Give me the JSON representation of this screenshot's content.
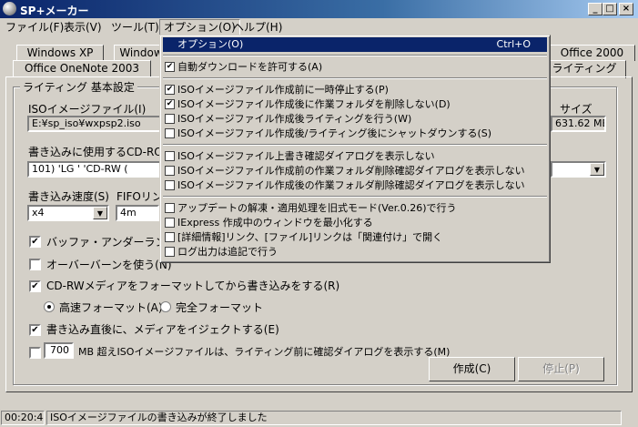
{
  "window": {
    "title": "SP+メーカー"
  },
  "titlebar_buttons": {
    "minimize": "_",
    "maximize": "□",
    "close": "×"
  },
  "menubar": [
    {
      "label": "ファイル(F)"
    },
    {
      "label": "表示(V)"
    },
    {
      "label": "ツール(T)"
    },
    {
      "label": "オプション(O)"
    },
    {
      "label": "ヘルプ(H)"
    }
  ],
  "tabs_back": [
    "Windows XP",
    "Window",
    "Office 2000"
  ],
  "tabs_front": [
    "Office OneNote 2003",
    "ライティング"
  ],
  "group": {
    "title": "ライティング 基本設定"
  },
  "iso": {
    "label": "ISOイメージファイル(I)",
    "value": "E:¥sp_iso¥wxpsp2.iso",
    "size_label": "サイズ",
    "size_value": "631.62 MB"
  },
  "drive": {
    "label": "書き込みに使用するCD-ROM",
    "value": "101) 'LG      ' 'CD-RW ("
  },
  "speed": {
    "label": "書き込み速度(S)",
    "value": "x4"
  },
  "fifo": {
    "label": "FIFOリン",
    "value": "4m"
  },
  "options": {
    "buffer_underrun": "バッファ・アンダーラン防止",
    "overburn": "オーバーバーンを使う(N)",
    "format_cdrw": "CD-RWメディアをフォーマットしてから書き込みをする(R)",
    "quick_format": "高速フォーマット(A)",
    "full_format": "完全フォーマット",
    "eject": "書き込み直後に、メディアをイジェクトする(E)",
    "mb_value": "700",
    "mb_label": "MB 超えISOイメージファイルは、ライティング前に確認ダイアログを表示する(M)"
  },
  "buttons": {
    "create": "作成(C)",
    "stop": "停止(P)"
  },
  "statusbar": {
    "time": "00:20:44",
    "message": "ISOイメージファイルの書き込みが終了しました"
  },
  "option_menu": {
    "header": {
      "label": "オプション(O)",
      "shortcut": "Ctrl+O"
    },
    "items": [
      {
        "label": "自動ダウンロードを許可する(A)",
        "checked": true
      },
      {
        "label": "ISOイメージファイル作成前に一時停止する(P)",
        "checked": true
      },
      {
        "label": "ISOイメージファイル作成後に作業フォルダを削除しない(D)",
        "checked": true
      },
      {
        "label": "ISOイメージファイル作成後ライティングを行う(W)",
        "checked": false
      },
      {
        "label": "ISOイメージファイル作成後/ライティング後にシャットダウンする(S)",
        "checked": false
      },
      {
        "label": "ISOイメージファイル上書き確認ダイアログを表示しない",
        "checked": false
      },
      {
        "label": "ISOイメージファイル作成前の作業フォルダ削除確認ダイアログを表示しない",
        "checked": false
      },
      {
        "label": "ISOイメージファイル作成後の作業フォルダ削除確認ダイアログを表示しない",
        "checked": false
      },
      {
        "label": "アップデートの解凍・適用処理を旧式モード(Ver.0.26)で行う",
        "checked": false
      },
      {
        "label": "IExpress 作成中のウィンドウを最小化する",
        "checked": false
      },
      {
        "label": "[詳細情報]リンク、[ファイル]リンクは「関連付け」で開く",
        "checked": false
      },
      {
        "label": "ログ出力は追記で行う",
        "checked": false
      }
    ]
  },
  "check_mark": "✔"
}
